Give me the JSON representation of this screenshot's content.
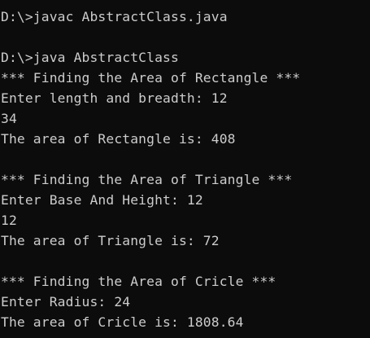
{
  "console": {
    "lines": [
      "D:\\>javac AbstractClass.java",
      "",
      "D:\\>java AbstractClass",
      "*** Finding the Area of Rectangle ***",
      "Enter length and breadth: 12",
      "34",
      "The area of Rectangle is: 408",
      "",
      "*** Finding the Area of Triangle ***",
      "Enter Base And Height: 12",
      "12",
      "The area of Triangle is: 72",
      "",
      "*** Finding the Area of Cricle ***",
      "Enter Radius: 24",
      "The area of Cricle is: 1808.64"
    ]
  },
  "colors": {
    "background": "#0c0c0c",
    "text": "#cccccc"
  }
}
